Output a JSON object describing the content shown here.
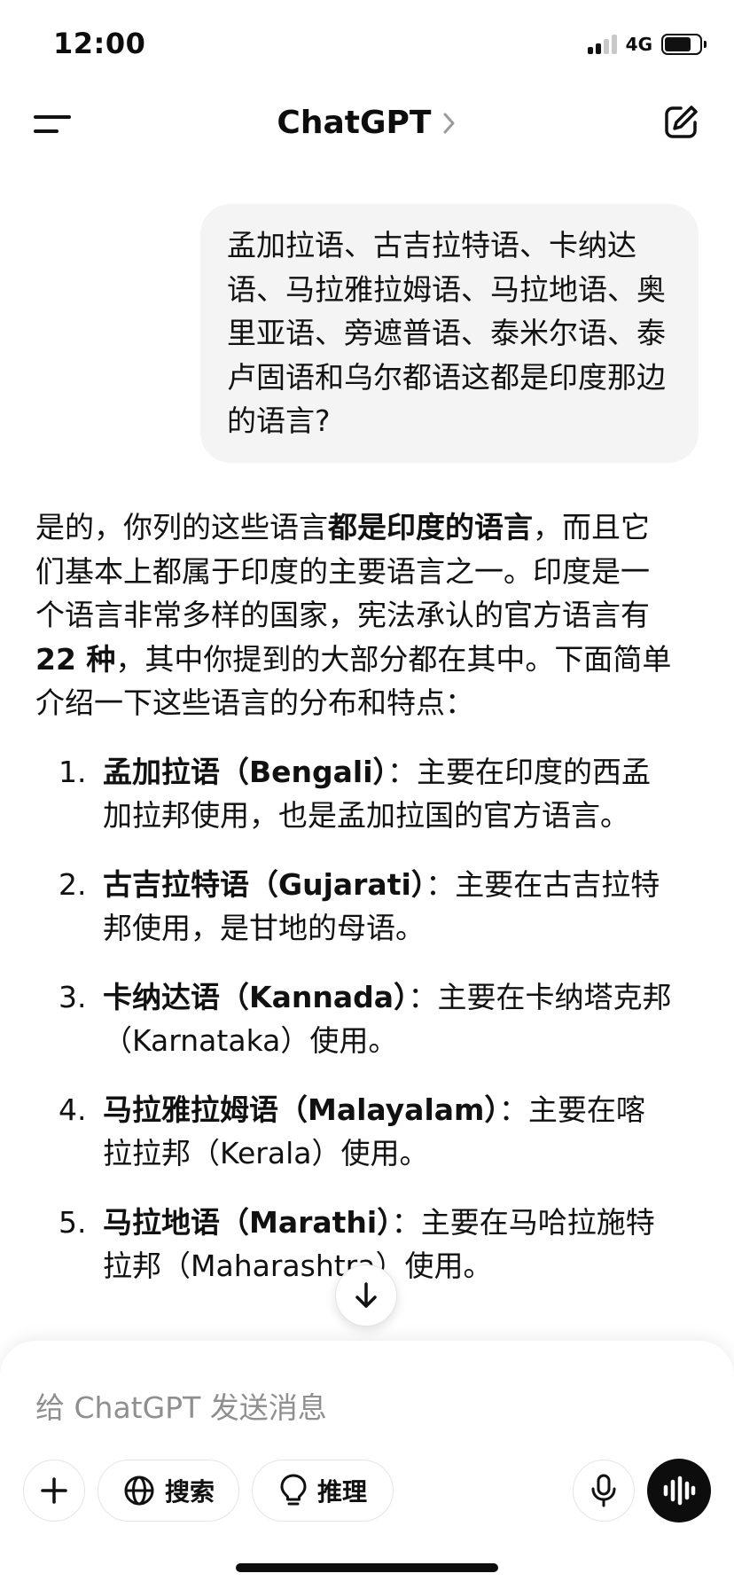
{
  "status_bar": {
    "time": "12:00",
    "network": "4G"
  },
  "header": {
    "title": "ChatGPT"
  },
  "user_message": "孟加拉语、古吉拉特语、卡纳达语、马拉雅拉姆语、马拉地语、奥里亚语、旁遮普语、泰米尔语、泰卢固语和乌尔都语这都是印度那边的语言?",
  "assistant": {
    "intro_parts": [
      "是的，你列的这些语言",
      "都是印度的语言",
      "，而且它们基本上都属于印度的主要语言之一。印度是一个语言非常多样的国家，宪法承认的官方语言有 ",
      "22 种",
      "，其中你提到的大部分都在其中。下面简单介绍一下这些语言的分布和特点："
    ],
    "items": [
      {
        "num": "1.",
        "term": "孟加拉语（Bengali）",
        "desc": "：主要在印度的西孟加拉邦使用，也是孟加拉国的官方语言。"
      },
      {
        "num": "2.",
        "term": "古吉拉特语（Gujarati）",
        "desc": "：主要在古吉拉特邦使用，是甘地的母语。"
      },
      {
        "num": "3.",
        "term": "卡纳达语（Kannada）",
        "desc": "：主要在卡纳塔克邦（Karnataka）使用。"
      },
      {
        "num": "4.",
        "term": "马拉雅拉姆语（Malayalam）",
        "desc": "：主要在喀拉拉邦（Kerala）使用。"
      },
      {
        "num": "5.",
        "term": "马拉地语（Marathi）",
        "desc": "：主要在马哈拉施特拉邦（Maharashtra）使用。"
      }
    ]
  },
  "composer": {
    "placeholder": "给 ChatGPT 发送消息",
    "search_label": "搜索",
    "reason_label": "推理"
  }
}
